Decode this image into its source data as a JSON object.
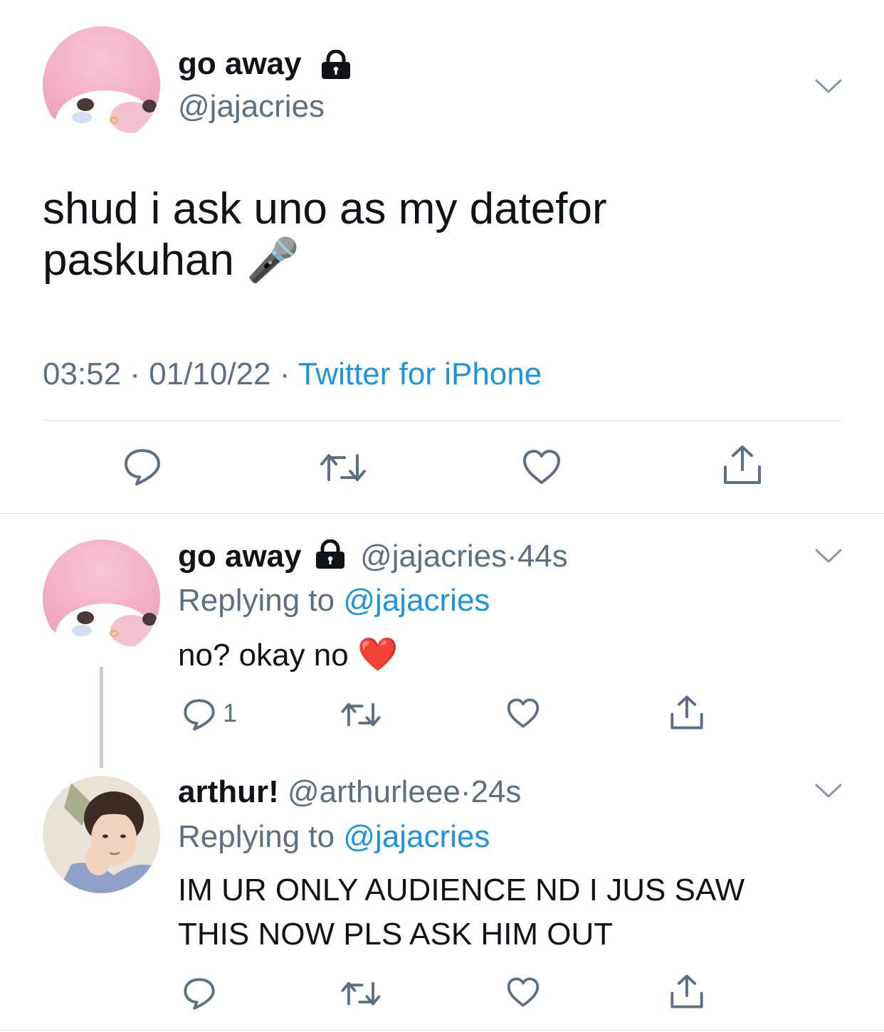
{
  "main_tweet": {
    "display_name": "go away",
    "handle": "@jajacries",
    "text_line1": "shud i ask uno as my datefor",
    "text_line2": "paskuhan",
    "emoji": "🎤",
    "time": "03:52",
    "date": "01/10/22",
    "sep": "·",
    "source": "Twitter for iPhone"
  },
  "replies": [
    {
      "display_name": "go away",
      "handle": "@jajacries",
      "sep": "·",
      "age": "44s",
      "replying_label": "Replying to",
      "replying_to": "@jajacries",
      "text": "no? okay no",
      "emoji": "❤️",
      "reply_count": "1"
    },
    {
      "display_name": "arthur!",
      "handle": "@arthurleee",
      "sep": "·",
      "age": "24s",
      "replying_label": "Replying to",
      "replying_to": "@jajacries",
      "text_line1": "IM UR ONLY AUDIENCE ND I JUS SAW",
      "text_line2": "THIS NOW PLS ASK HIM OUT"
    }
  ],
  "colors": {
    "text": "#0f1419",
    "secondary": "#5b7083",
    "link": "#1b95e0",
    "divider": "#dfe3e6",
    "thread_line": "#c4cfd6"
  }
}
